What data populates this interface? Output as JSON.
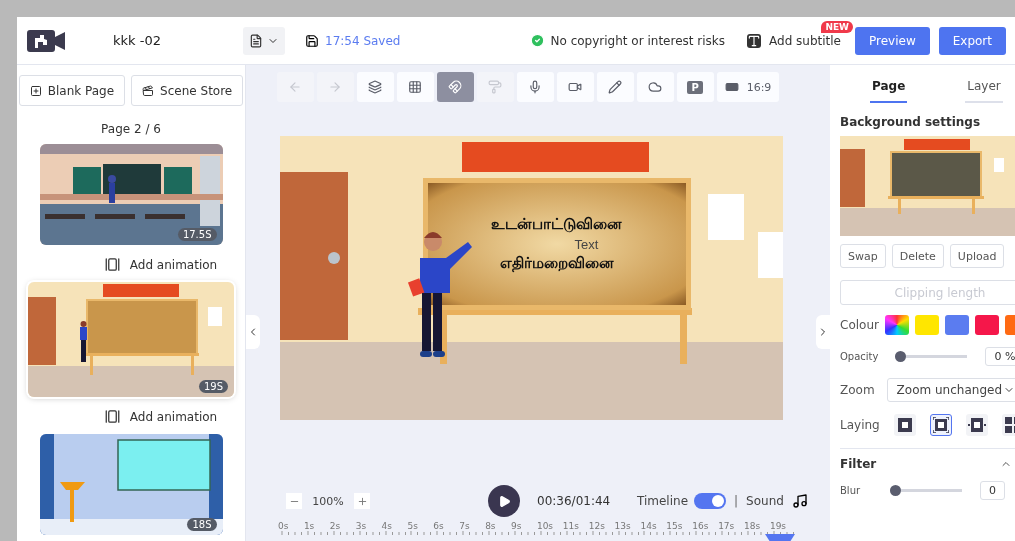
{
  "header": {
    "title": "kkk -02",
    "save_status": "17:54 Saved",
    "copyright_status": "No copyright or interest risks",
    "subtitle_button": {
      "label": "Add subtitle",
      "badge": "NEW"
    },
    "buttons": [
      "Preview",
      "Export"
    ]
  },
  "left_panel": {
    "buttons": [
      {
        "kind": "blank",
        "label": "Blank Page"
      },
      {
        "kind": "store",
        "label": "Scene Store"
      }
    ],
    "page_indicator": "Page 2 / 6",
    "scenes": [
      {
        "kind": "classroom",
        "duration": "17.5S",
        "selected": false,
        "action": "Add animation"
      },
      {
        "kind": "blackboard",
        "duration": "19S",
        "selected": true,
        "action": "Add animation"
      },
      {
        "kind": "stage",
        "duration": "18S",
        "selected": false
      }
    ]
  },
  "toolbar": [
    {
      "kind": "undo",
      "disabled": true,
      "active": false
    },
    {
      "kind": "redo",
      "disabled": true,
      "active": false
    },
    {
      "kind": "layers",
      "disabled": false,
      "active": false
    },
    {
      "kind": "grid",
      "disabled": false,
      "active": false
    },
    {
      "kind": "magnet",
      "disabled": false,
      "active": true
    },
    {
      "kind": "roller",
      "disabled": true,
      "active": false
    },
    {
      "kind": "mic",
      "disabled": false,
      "active": false
    },
    {
      "kind": "camera",
      "disabled": false,
      "active": false
    },
    {
      "kind": "pencil",
      "disabled": false,
      "active": false
    },
    {
      "kind": "cloud",
      "disabled": false,
      "active": false
    },
    {
      "kind": "letter",
      "label": "P",
      "disabled": false,
      "active": false
    },
    {
      "kind": "ratio",
      "label": "16:9",
      "disabled": false,
      "active": false
    }
  ],
  "canvas": {
    "heading": "உடன்பாட்டுவினை",
    "text": "Text",
    "subheading": "எதிர்மறைவினை"
  },
  "playback": {
    "zoom": "100%",
    "time": "00:36/01:44",
    "timeline_label": "Timeline",
    "timeline_on": true,
    "separator": "|",
    "sound_label": "Sound"
  },
  "ruler": [
    "0s",
    "1s",
    "2s",
    "3s",
    "4s",
    "5s",
    "6s",
    "7s",
    "8s",
    "9s",
    "10s",
    "11s",
    "12s",
    "13s",
    "14s",
    "15s",
    "16s",
    "17s",
    "18s",
    "19s"
  ],
  "right_panel": {
    "tabs": [
      {
        "label": "Page",
        "selected": true
      },
      {
        "label": "Layer",
        "selected": false
      }
    ],
    "section_title": "Background settings",
    "background_buttons": [
      "Swap",
      "Delete",
      "Upload"
    ],
    "clipping_button": {
      "label": "Clipping length",
      "disabled": true
    },
    "colour": {
      "label": "Colour",
      "swatches": [
        {
          "kind": "spectrum"
        },
        {
          "kind": "solid",
          "color": "#ffe600"
        },
        {
          "kind": "solid",
          "color": "#5b7cf0"
        },
        {
          "kind": "solid",
          "color": "#f5174a"
        },
        {
          "kind": "solid",
          "color": "#ff6a13"
        }
      ]
    },
    "opacity": {
      "label": "Opacity",
      "level": 0,
      "reading": "0 %"
    },
    "zoom": {
      "label": "Zoom",
      "value": "Zoom unchanged"
    },
    "laying": {
      "label": "Laying",
      "options": [
        {
          "kind": "center",
          "selected": false
        },
        {
          "kind": "fit",
          "selected": true
        },
        {
          "kind": "stretch",
          "selected": false
        },
        {
          "kind": "tile",
          "selected": false
        }
      ]
    },
    "filter": {
      "title": "Filter",
      "expanded": true,
      "sliders": [
        {
          "label": "Blur",
          "level": 0,
          "reading": "0"
        }
      ]
    }
  }
}
